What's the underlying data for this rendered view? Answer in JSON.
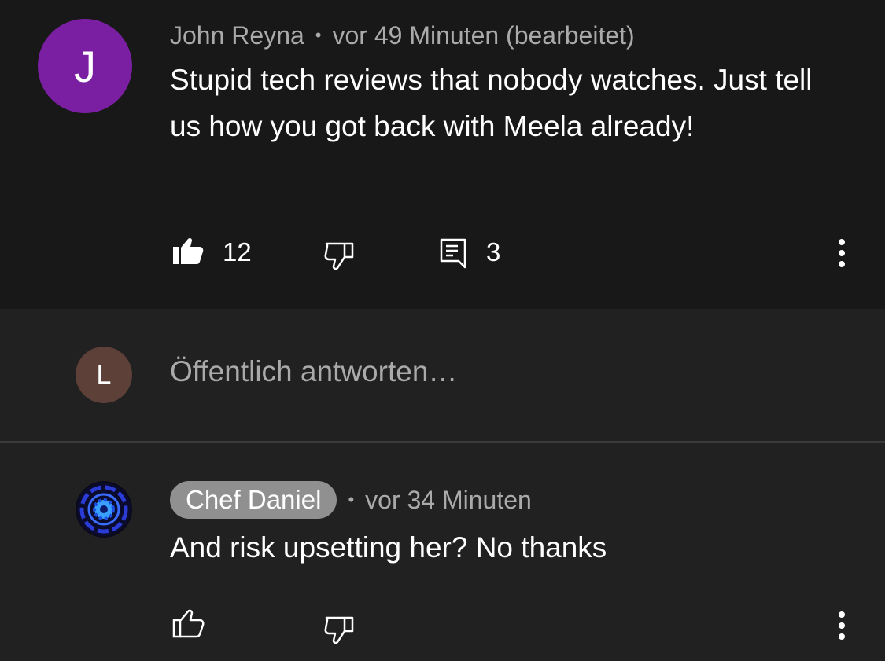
{
  "comment1": {
    "avatar_letter": "J",
    "avatar_color": "#7b1fa2",
    "author": "John Reyna",
    "separator": "•",
    "time": "vor 49 Minuten (bearbeitet)",
    "text": "Stupid tech reviews that nobody watches. Just tell us how you got back with Meela already!",
    "likes": "12",
    "replies": "3",
    "liked": true,
    "icons": [
      "thumb-up-filled-icon",
      "thumb-down-icon",
      "reply-icon",
      "more-vert-icon"
    ]
  },
  "reply_box": {
    "avatar_letter": "L",
    "avatar_color": "#5d4037",
    "placeholder": "Öffentlich antworten…"
  },
  "comment2": {
    "author": "Chef Daniel",
    "separator": "•",
    "time": "vor 34 Minuten",
    "text": "And risk upsetting her? No thanks",
    "icons": [
      "thumb-up-icon",
      "thumb-down-icon",
      "more-vert-icon"
    ]
  }
}
